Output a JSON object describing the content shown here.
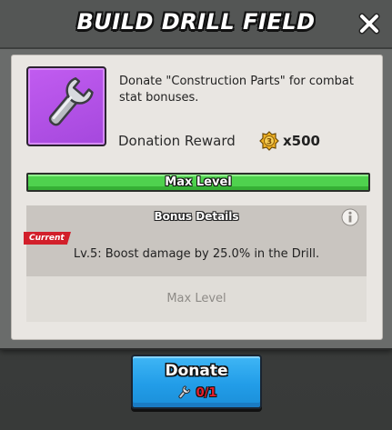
{
  "dialog": {
    "title": "BUILD DRILL FIELD",
    "close_icon": "close-icon"
  },
  "item": {
    "icon": "wrench-icon",
    "description": "Donate \"Construction Parts\" for combat stat bonuses."
  },
  "reward": {
    "label": "Donation Reward",
    "icon": "medal-icon",
    "amount": "x500"
  },
  "level": {
    "label": "Max Level",
    "progress": 1.0
  },
  "bonus": {
    "title": "Bonus Details",
    "info_icon": "info-icon",
    "current_tag": "Current",
    "current_text": "Lv.5: Boost damage by 25.0% in the Drill.",
    "next_text": "Max Level"
  },
  "donate": {
    "label": "Donate",
    "cost_icon": "wrench-icon",
    "cost": "0/1"
  },
  "colors": {
    "accent_green": "#4fd24e",
    "button_blue": "#229de8",
    "tag_red": "#d21f2a",
    "item_purple": "#b050e6"
  }
}
